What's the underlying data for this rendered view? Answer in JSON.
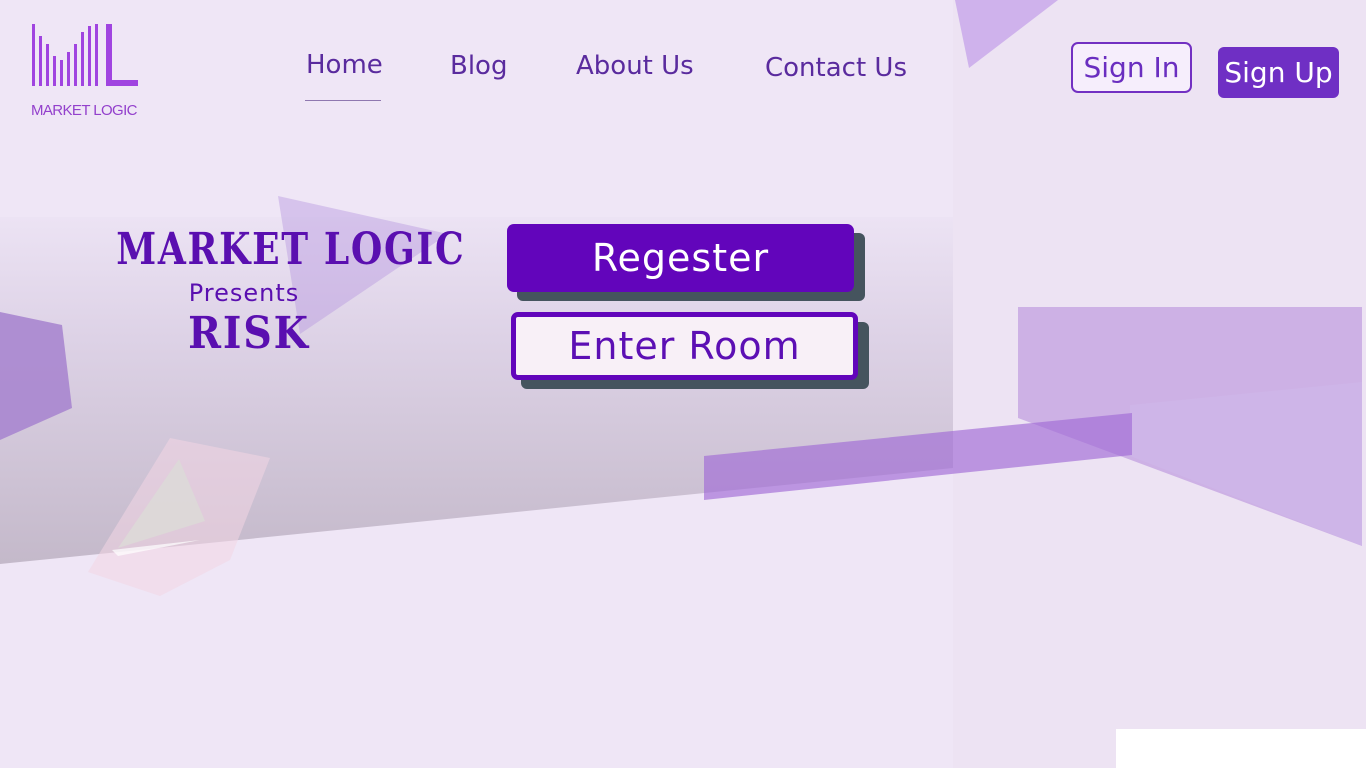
{
  "brand": {
    "logo_text": "MARKET LOGIC",
    "logo_icon": "bar-chart-logo-icon",
    "accent_color": "#a044e0"
  },
  "nav": {
    "items": [
      {
        "label": "Home",
        "active": true
      },
      {
        "label": "Blog",
        "active": false
      },
      {
        "label": "About Us",
        "active": false
      },
      {
        "label": "Contact Us",
        "active": false
      }
    ]
  },
  "auth": {
    "sign_in_label": "Sign In",
    "sign_up_label": "Sign Up"
  },
  "hero": {
    "title": "MARKET LOGIC",
    "subtitle": "Presents",
    "game_name": "RISK"
  },
  "actions": {
    "register_label": "Regester",
    "enter_room_label": "Enter Room",
    "primary_color": "#6205bb",
    "shadow_color": "#45545e"
  }
}
